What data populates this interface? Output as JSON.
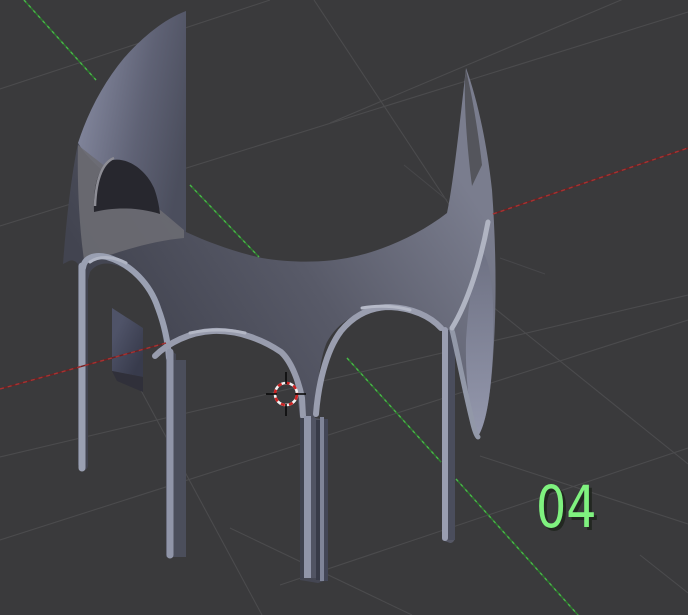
{
  "viewport": {
    "type": "3d-viewport",
    "frame_label": "04",
    "background_color": "#3a3a3c",
    "grid_color": "#4b4b4d",
    "axis_x_color": "#8a2727",
    "axis_y_color": "#3d9e3d",
    "frame_label_color": "#7ff27f",
    "model": "arched-cylindrical-colonnade",
    "cursor": "3d-cursor"
  }
}
